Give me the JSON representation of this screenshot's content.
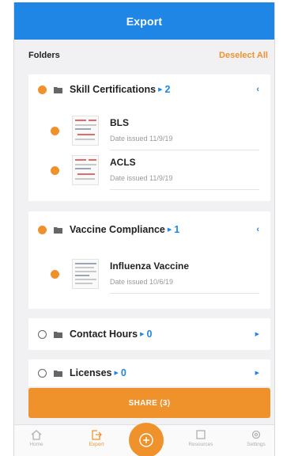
{
  "header": {
    "title": "Export"
  },
  "folders_bar": {
    "label": "Folders",
    "deselect_label": "Deselect All"
  },
  "folders": [
    {
      "title": "Skill Certifications",
      "count": "2",
      "selected": true,
      "expanded": true,
      "docs": [
        {
          "name": "BLS",
          "date": "Date issued 11/9/19",
          "selected": true
        },
        {
          "name": "ACLS",
          "date": "Date issued 11/9/19",
          "selected": true
        }
      ]
    },
    {
      "title": "Vaccine Compliance",
      "count": "1",
      "selected": true,
      "expanded": true,
      "docs": [
        {
          "name": "Influenza Vaccine",
          "date": "Date issued 10/6/19",
          "selected": true
        }
      ]
    },
    {
      "title": "Contact Hours",
      "count": "0",
      "selected": false,
      "expanded": false
    },
    {
      "title": "Licenses",
      "count": "0",
      "selected": false,
      "expanded": false
    }
  ],
  "share_button": {
    "label": "SHARE (3)"
  },
  "tabs": [
    {
      "label": "Home",
      "icon": "home-icon"
    },
    {
      "label": "Export",
      "icon": "export-icon",
      "active": true
    },
    {
      "label": "",
      "icon": "add-icon"
    },
    {
      "label": "Resources",
      "icon": "resources-icon"
    },
    {
      "label": "Settings",
      "icon": "settings-icon"
    }
  ],
  "colors": {
    "primary": "#1f86e5",
    "accent": "#f0922b"
  }
}
